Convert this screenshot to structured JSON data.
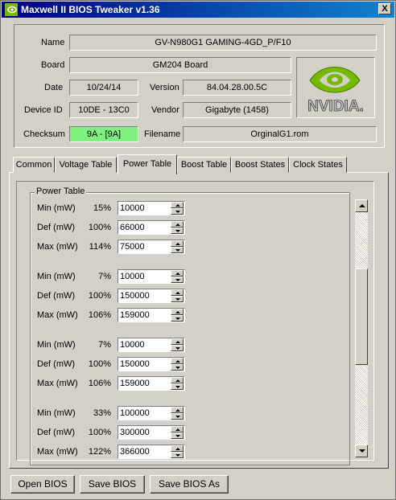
{
  "window": {
    "title": "Maxwell II BIOS Tweaker v1.36",
    "close_label": "X"
  },
  "info": {
    "name_label": "Name",
    "name_value": "GV-N980G1 GAMING-4GD_P/F10",
    "board_label": "Board",
    "board_value": "GM204 Board",
    "date_label": "Date",
    "date_value": "10/24/14",
    "version_label": "Version",
    "version_value": "84.04.28.00.5C",
    "device_label": "Device ID",
    "device_value": "10DE - 13C0",
    "vendor_label": "Vendor",
    "vendor_value": "Gigabyte (1458)",
    "checksum_label": "Checksum",
    "checksum_value": "9A - [9A]",
    "filename_label": "Filename",
    "filename_value": "OrginalG1.rom",
    "checksum_color": "#80f080",
    "logo_text": "NVIDIA.",
    "logo_color": "#76b900"
  },
  "tabs": [
    "Common",
    "Voltage Table",
    "Power Table",
    "Boost Table",
    "Boost States",
    "Clock States"
  ],
  "active_tab": "Power Table",
  "power_table": {
    "title": "Power Table",
    "groups": [
      [
        {
          "label": "Min (mW)",
          "pct": "15%",
          "value": "10000"
        },
        {
          "label": "Def (mW)",
          "pct": "100%",
          "value": "66000"
        },
        {
          "label": "Max (mW)",
          "pct": "114%",
          "value": "75000"
        }
      ],
      [
        {
          "label": "Min (mW)",
          "pct": "7%",
          "value": "10000"
        },
        {
          "label": "Def (mW)",
          "pct": "100%",
          "value": "150000"
        },
        {
          "label": "Max (mW)",
          "pct": "106%",
          "value": "159000"
        }
      ],
      [
        {
          "label": "Min (mW)",
          "pct": "7%",
          "value": "10000"
        },
        {
          "label": "Def (mW)",
          "pct": "100%",
          "value": "150000"
        },
        {
          "label": "Max (mW)",
          "pct": "106%",
          "value": "159000"
        }
      ],
      [
        {
          "label": "Min (mW)",
          "pct": "33%",
          "value": "100000"
        },
        {
          "label": "Def (mW)",
          "pct": "100%",
          "value": "300000"
        },
        {
          "label": "Max (mW)",
          "pct": "122%",
          "value": "366000"
        }
      ]
    ]
  },
  "buttons": {
    "open": "Open BIOS",
    "save": "Save BIOS",
    "save_as": "Save BIOS As"
  }
}
